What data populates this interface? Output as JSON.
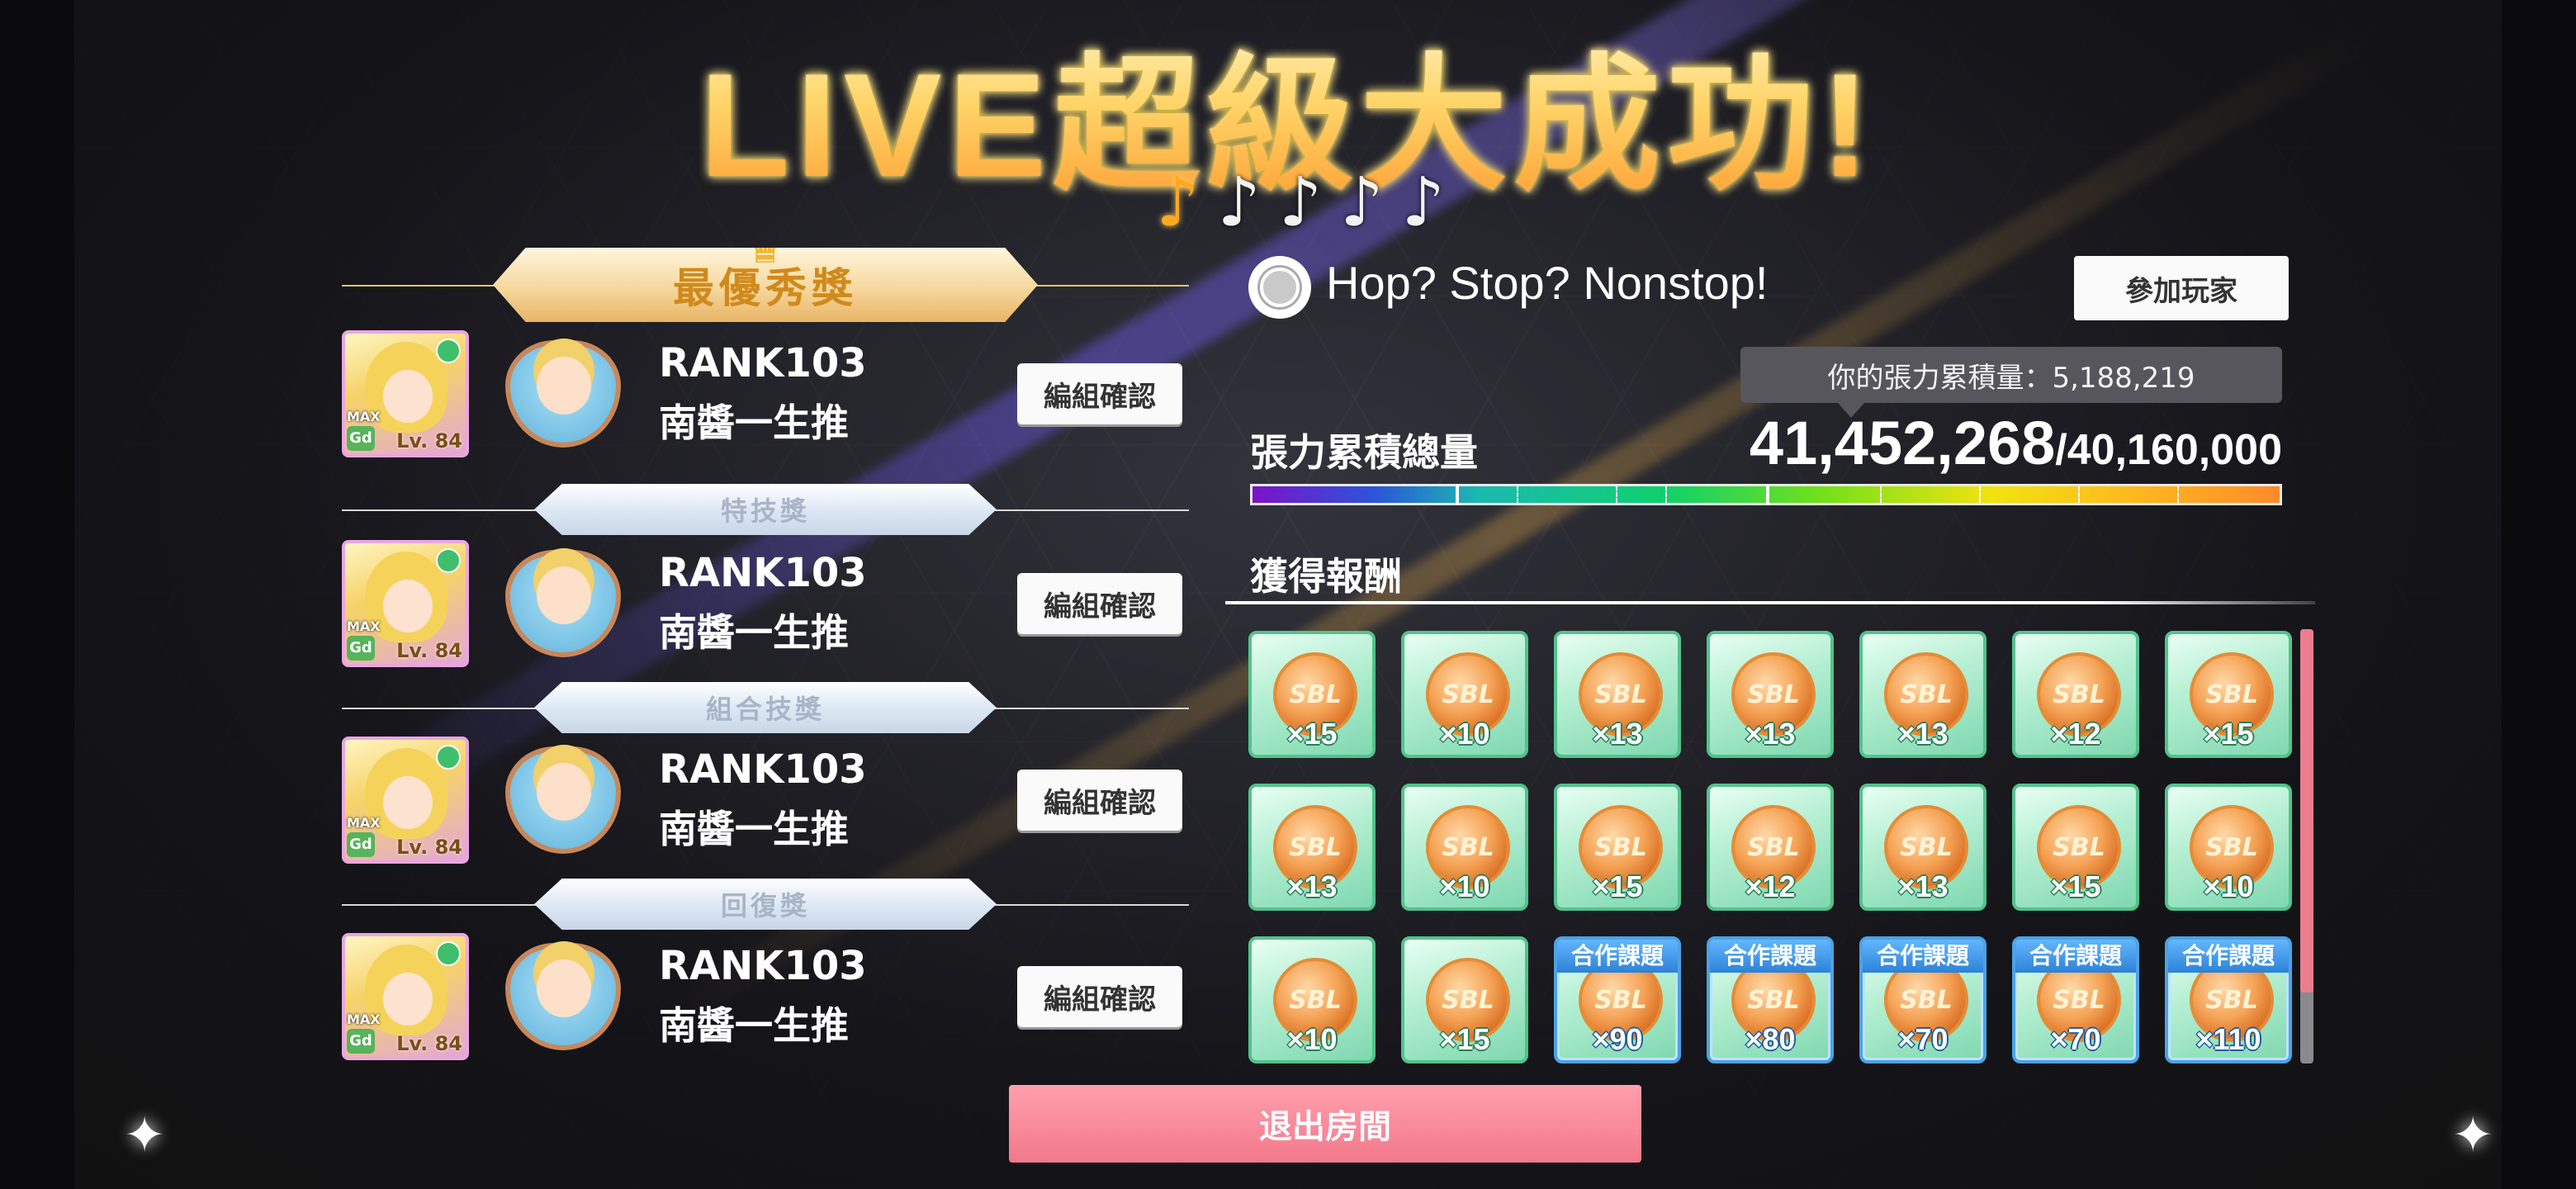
{
  "title": "LIVE超級大成功!",
  "notes": {
    "total": 5,
    "lit": 1,
    "symbol": "♪"
  },
  "awards": {
    "main": "最優秀獎",
    "skill": "特技獎",
    "combo": "組合技獎",
    "recovery": "回復獎"
  },
  "players": [
    {
      "rank": "RANK103",
      "name": "南醬一生推",
      "level": "Lv. 84",
      "button": "編組確認"
    },
    {
      "rank": "RANK103",
      "name": "南醬一生推",
      "level": "Lv. 84",
      "button": "編組確認"
    },
    {
      "rank": "RANK103",
      "name": "南醬一生推",
      "level": "Lv. 84",
      "button": "編組確認"
    },
    {
      "rank": "RANK103",
      "name": "南醬一生推",
      "level": "Lv. 84",
      "button": "編組確認"
    }
  ],
  "card_badges": {
    "max": "MAX",
    "rarity": "Gd"
  },
  "song": {
    "title": "Hop? Stop? Nonstop!"
  },
  "join_button": "參加玩家",
  "tension": {
    "your_label": "你的張力累積量：5,188,219",
    "label": "張力累積總量",
    "total": "41,452,268",
    "goal": "/40,160,000"
  },
  "rewards": {
    "label": "獲得報酬",
    "coin_text": "SBL",
    "coop_tag": "合作課題",
    "items": [
      {
        "qty": "×15",
        "coop": false
      },
      {
        "qty": "×10",
        "coop": false
      },
      {
        "qty": "×13",
        "coop": false
      },
      {
        "qty": "×13",
        "coop": false
      },
      {
        "qty": "×13",
        "coop": false
      },
      {
        "qty": "×12",
        "coop": false
      },
      {
        "qty": "×15",
        "coop": false
      },
      {
        "qty": "×13",
        "coop": false
      },
      {
        "qty": "×10",
        "coop": false
      },
      {
        "qty": "×15",
        "coop": false
      },
      {
        "qty": "×12",
        "coop": false
      },
      {
        "qty": "×13",
        "coop": false
      },
      {
        "qty": "×15",
        "coop": false
      },
      {
        "qty": "×10",
        "coop": false
      },
      {
        "qty": "×10",
        "coop": false
      },
      {
        "qty": "×15",
        "coop": false
      },
      {
        "qty": "×90",
        "coop": true
      },
      {
        "qty": "×80",
        "coop": true
      },
      {
        "qty": "×70",
        "coop": true
      },
      {
        "qty": "×70",
        "coop": true
      },
      {
        "qty": "×110",
        "coop": true
      }
    ]
  },
  "exit_button": "退出房間"
}
